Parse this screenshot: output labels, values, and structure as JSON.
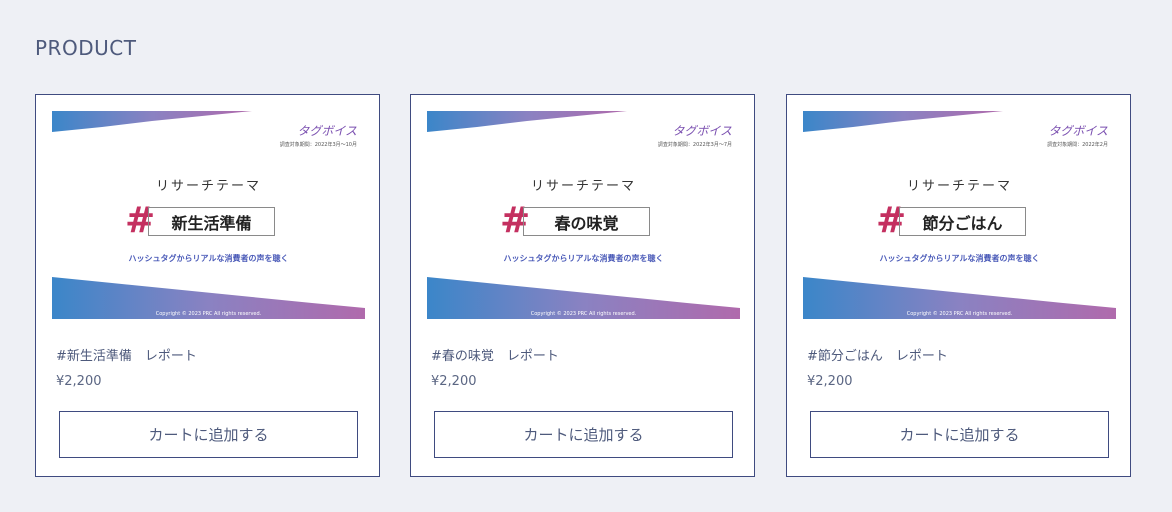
{
  "section_title": "PRODUCT",
  "brand_colors": {
    "accent": "#3f4b80",
    "hash": "#c43060",
    "gradient_start": "#3b86c9",
    "gradient_end": "#b06aac"
  },
  "products": [
    {
      "thumb": {
        "brand": "タグボイス",
        "period": "調査対象期間：2022年3月〜10月",
        "theme": "リサーチテーマ",
        "hash": "#",
        "title": "新生活準備",
        "tagline": "ハッシュタグからリアルな消費者の声を聴く",
        "copyright": "Copyright © 2023 PRC All rights reserved."
      },
      "name": "#新生活準備　レポート",
      "price": "¥2,200",
      "button_label": "カートに追加する"
    },
    {
      "thumb": {
        "brand": "タグボイス",
        "period": "調査対象期間：2022年3月〜7月",
        "theme": "リサーチテーマ",
        "hash": "#",
        "title": "春の味覚",
        "tagline": "ハッシュタグからリアルな消費者の声を聴く",
        "copyright": "Copyright © 2023 PRC All rights reserved."
      },
      "name": "#春の味覚　レポート",
      "price": "¥2,200",
      "button_label": "カートに追加する"
    },
    {
      "thumb": {
        "brand": "タグボイス",
        "period": "調査対象期間：2022年2月",
        "theme": "リサーチテーマ",
        "hash": "#",
        "title": "節分ごはん",
        "tagline": "ハッシュタグからリアルな消費者の声を聴く",
        "copyright": "Copyright © 2023 PRC All rights reserved."
      },
      "name": "#節分ごはん　レポート",
      "price": "¥2,200",
      "button_label": "カートに追加する"
    }
  ]
}
